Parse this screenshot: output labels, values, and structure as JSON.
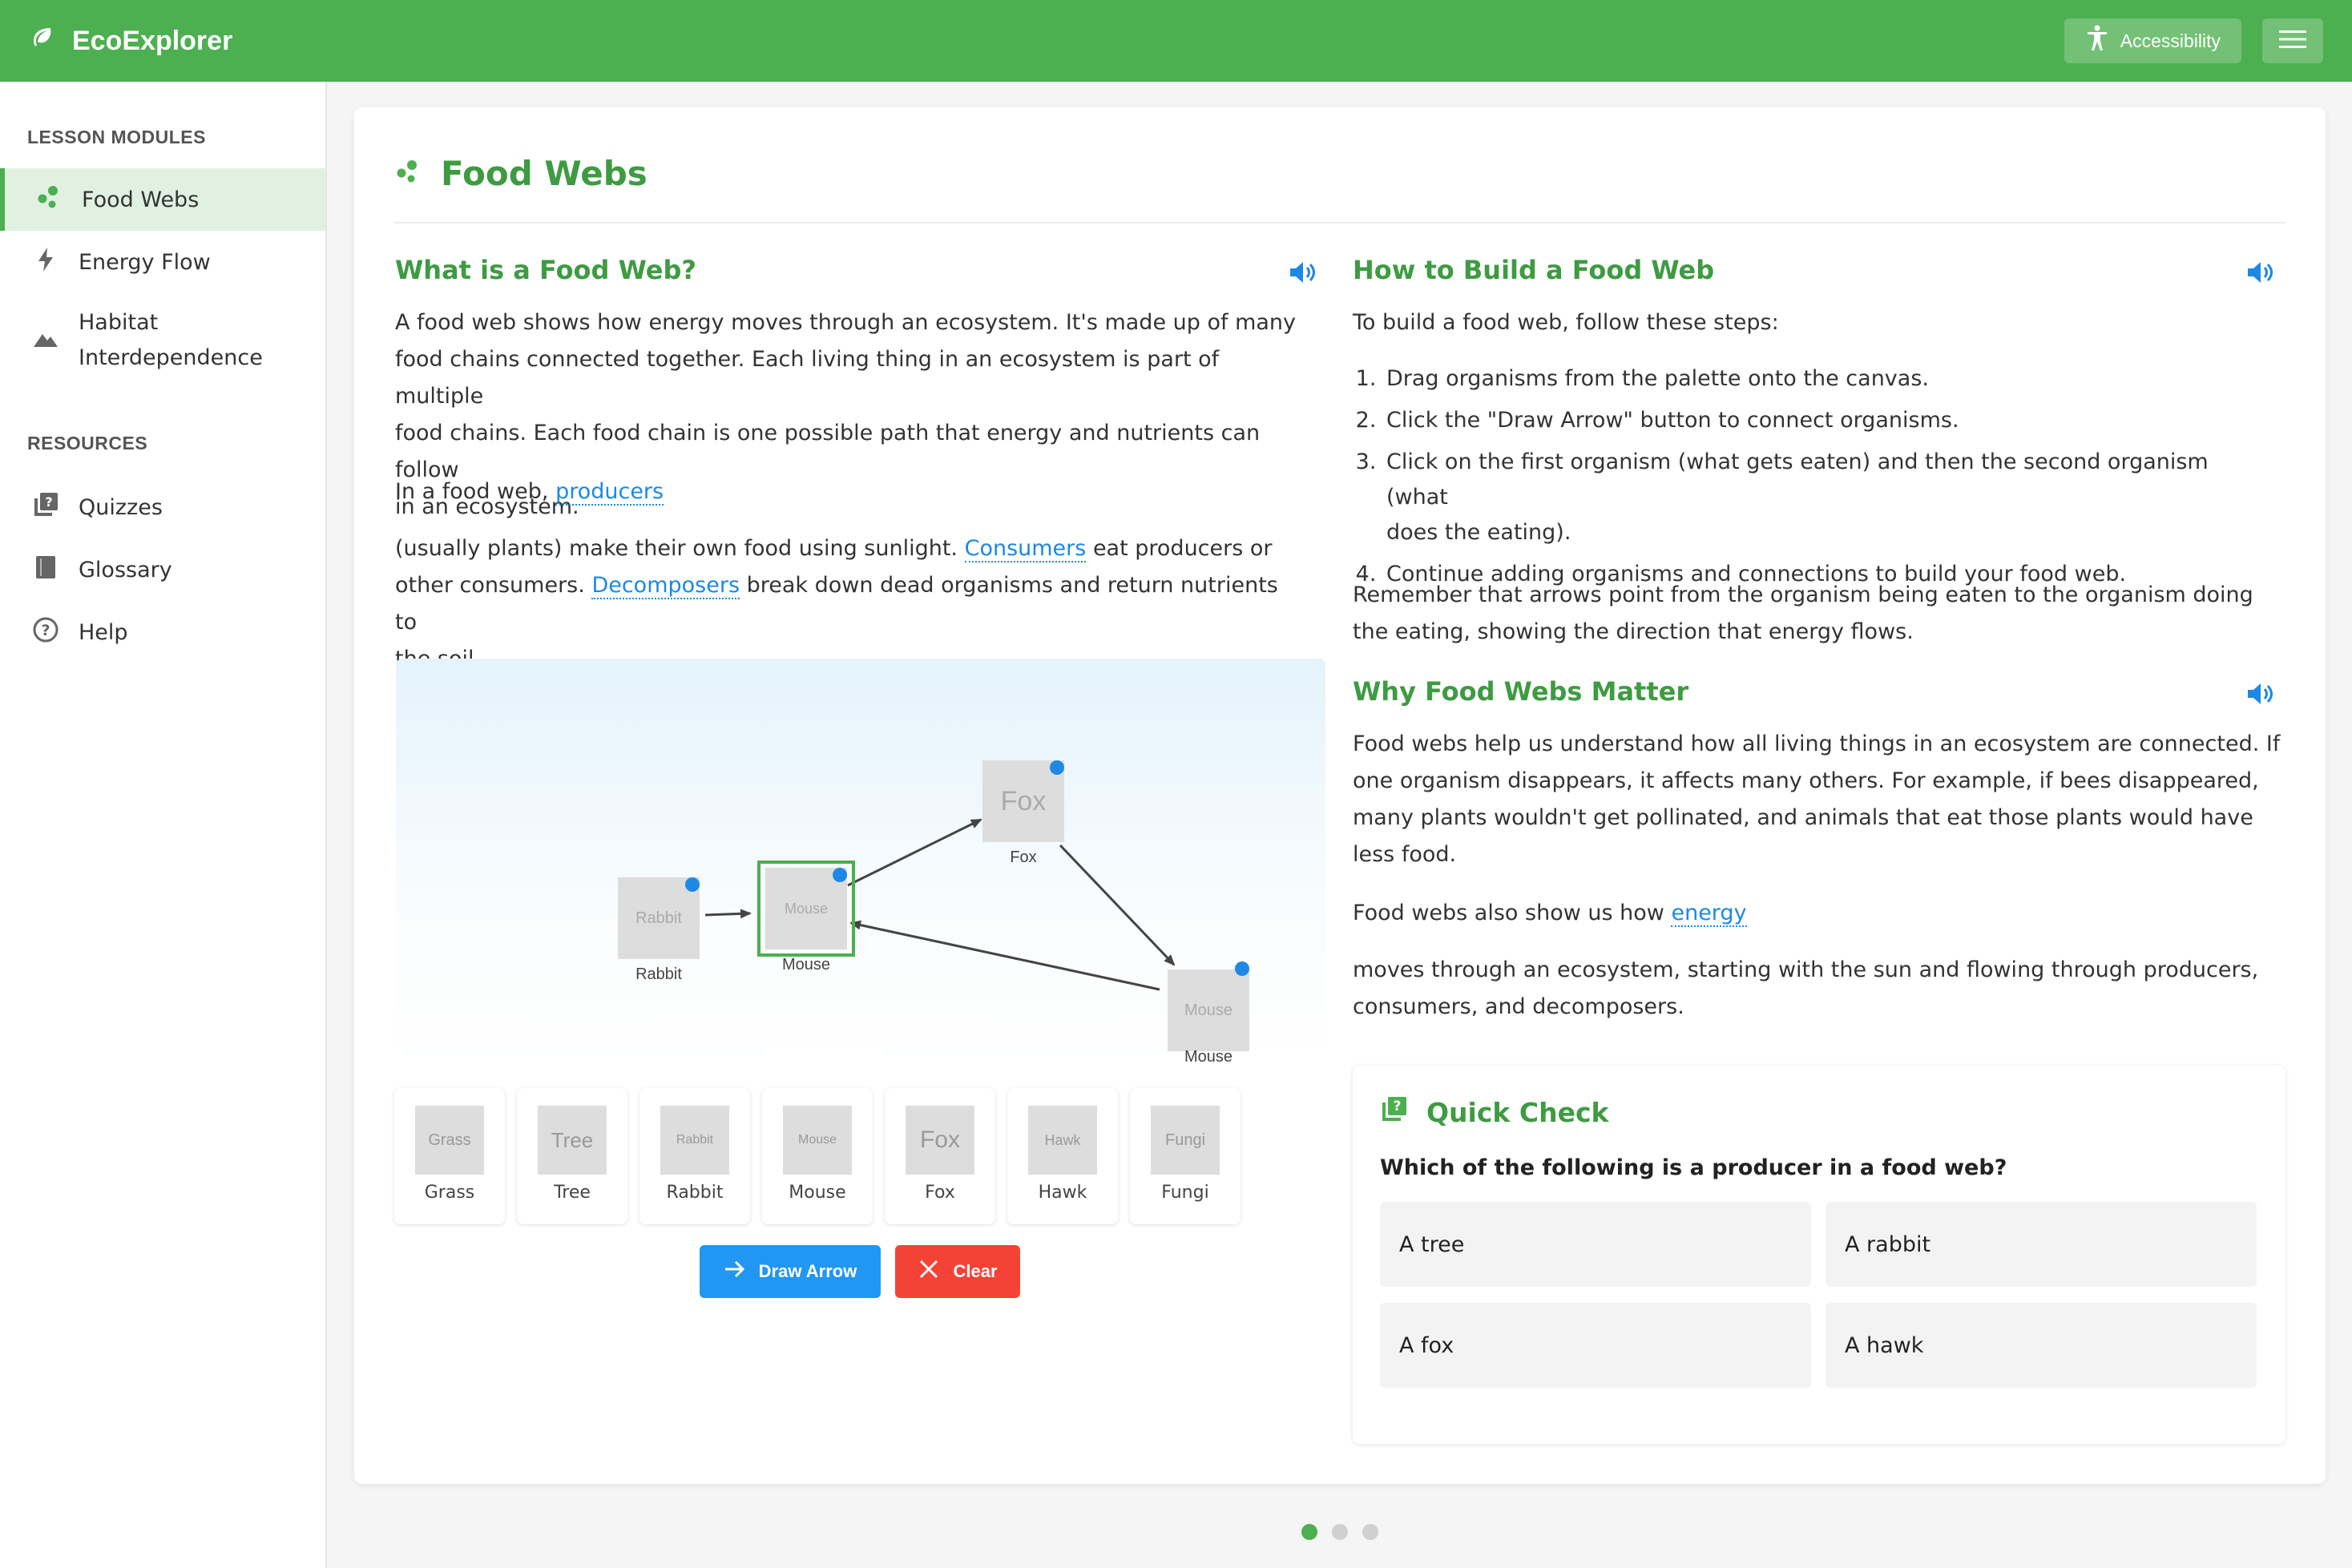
{
  "app": {
    "title": "EcoExplorer",
    "accessibility_label": "Accessibility"
  },
  "colors": {
    "brand": "#4caf50",
    "heading": "#3e9b42",
    "link": "#1e88e5",
    "danger": "#f44336",
    "primary": "#2196f3"
  },
  "sidebar": {
    "lesson_heading": "LESSON MODULES",
    "lessons": [
      {
        "label": "Food Webs",
        "icon": "food-web-icon",
        "active": true
      },
      {
        "label": "Energy Flow",
        "icon": "bolt-icon"
      },
      {
        "label_line1": "Habitat",
        "label_line2": "Interdependence",
        "icon": "mountain-icon"
      }
    ],
    "resources_heading": "RESOURCES",
    "resources": [
      {
        "label": "Quizzes",
        "icon": "quiz-icon"
      },
      {
        "label": "Glossary",
        "icon": "book-icon"
      },
      {
        "label": "Help",
        "icon": "help-icon"
      }
    ]
  },
  "page": {
    "title": "Food Webs"
  },
  "what": {
    "title": "What is a Food Web?",
    "p1_l1": "A food web shows how energy moves through an ecosystem. It's made up of many",
    "p1_l2": "food chains connected together. Each living thing in an ecosystem is part of multiple",
    "p1_l3": "food chains. Each food chain is one possible path that energy and nutrients can follow",
    "p1_l4": "in an ecosystem.",
    "p2_prefix": "In a food web,",
    "p2_link": "producers",
    "p3_l1_a": "(usually plants) make their own food using sunlight.",
    "p3_l1_link": "Consumers",
    "p3_l1_b": "eat producers or",
    "p3_l2_a": "other consumers.",
    "p3_l2_link": "Decomposers",
    "p3_l2_b": "break down dead organisms and return nutrients to",
    "p3_l3": "the soil."
  },
  "canvas": {
    "nodes": [
      {
        "id": "rabbit",
        "label": "Rabbit",
        "image_text": "Rabbit"
      },
      {
        "id": "mouse1",
        "label": "Mouse",
        "image_text": "Mouse",
        "selected": true
      },
      {
        "id": "fox",
        "label": "Fox",
        "image_text": "Fox"
      },
      {
        "id": "mouse2",
        "label": "Mouse",
        "image_text": "Mouse"
      }
    ],
    "arrows": [
      {
        "from": "rabbit",
        "to": "mouse1"
      },
      {
        "from": "mouse1",
        "to": "fox"
      },
      {
        "from": "fox",
        "to": "mouse2"
      },
      {
        "from": "mouse2",
        "to": "mouse1"
      }
    ]
  },
  "palette": [
    {
      "name": "Grass",
      "image_text": "Grass"
    },
    {
      "name": "Tree",
      "image_text": "Tree"
    },
    {
      "name": "Rabbit",
      "image_text": "Rabbit"
    },
    {
      "name": "Mouse",
      "image_text": "Mouse"
    },
    {
      "name": "Fox",
      "image_text": "Fox"
    },
    {
      "name": "Hawk",
      "image_text": "Hawk"
    },
    {
      "name": "Fungi",
      "image_text": "Fungi"
    }
  ],
  "buttons": {
    "draw_arrow": "Draw Arrow",
    "clear": "Clear"
  },
  "how": {
    "title": "How to Build a Food Web",
    "intro": "To build a food web, follow these steps:",
    "steps": [
      {
        "text": "Drag organisms from the palette onto the canvas."
      },
      {
        "text": "Click the \"Draw Arrow\" button to connect organisms."
      },
      {
        "text_l1": "Click on the first organism (what gets eaten) and then the second organism (what",
        "text_l2": "does the eating)."
      },
      {
        "text": "Continue adding organisms and connections to build your food web."
      }
    ],
    "note_l1": "Remember that arrows point from the organism being eaten to the organism doing",
    "note_l2": "the eating, showing the direction that energy flows."
  },
  "why": {
    "title": "Why Food Webs Matter",
    "p1_l1": "Food webs help us understand how all living things in an ecosystem are connected. If",
    "p1_l2": "one organism disappears, it affects many others. For example, if bees disappeared,",
    "p1_l3": "many plants wouldn't get pollinated, and animals that eat those plants would have",
    "p1_l4": "less food.",
    "p2_prefix": "Food webs also show us how",
    "p2_link": "energy",
    "p3_l1": "moves through an ecosystem, starting with the sun and flowing through producers,",
    "p3_l2": "consumers, and decomposers."
  },
  "quick_check": {
    "title": "Quick Check",
    "question": "Which of the following is a producer in a food web?",
    "options": [
      "A tree",
      "A rabbit",
      "A fox",
      "A hawk"
    ]
  },
  "pager": {
    "total": 3,
    "current": 1
  }
}
